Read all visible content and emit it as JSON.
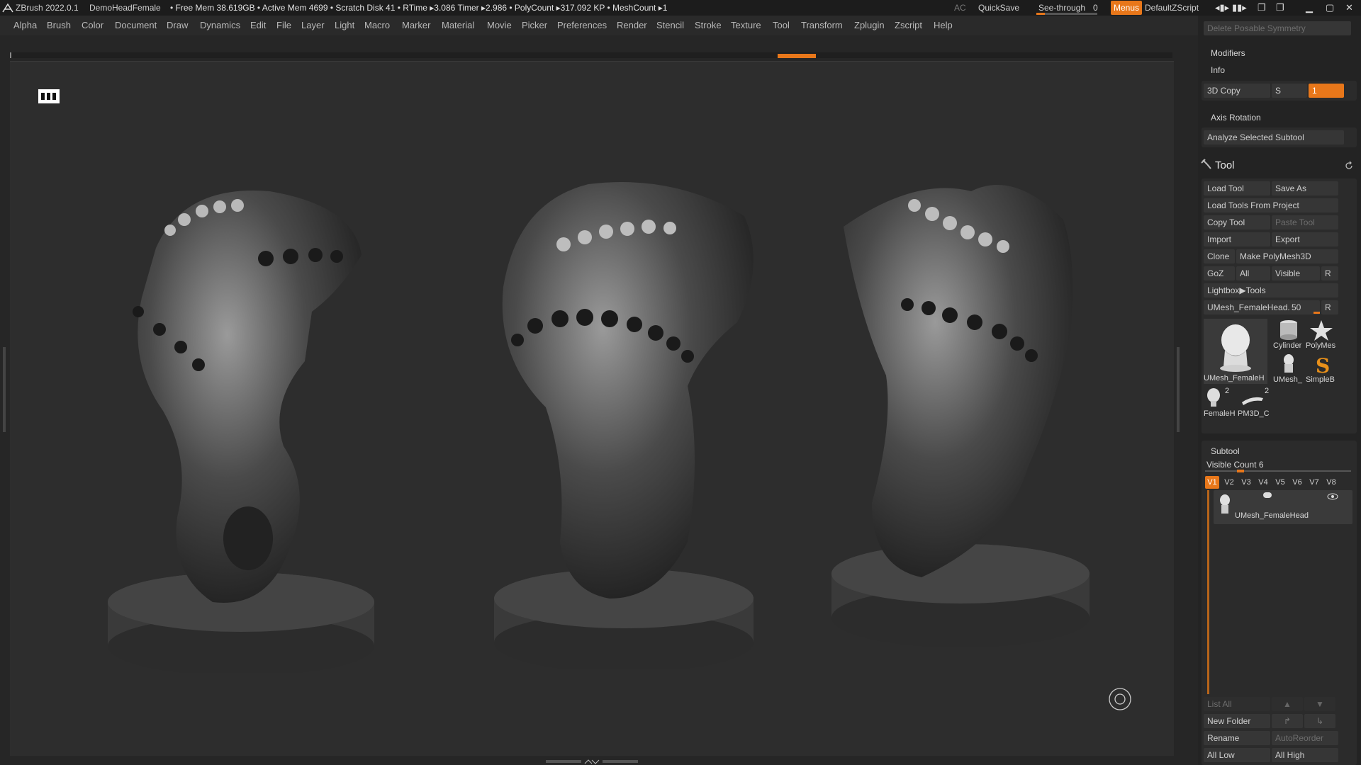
{
  "titlebar": {
    "app": "ZBrush 2022.0.1",
    "document": "DemoHeadFemale",
    "stats": "• Free Mem 38.619GB • Active Mem 4699 • Scratch Disk 41 • RTime ▸3.086 Timer ▸2.986 • PolyCount ▸317.092 KP  • MeshCount ▸1",
    "ac": "AC",
    "quicksave": "QuickSave",
    "see_through_label": "See-through",
    "see_through_value": "0",
    "menus": "Menus",
    "script": "DefaultZScript"
  },
  "menu": [
    "Alpha",
    "Brush",
    "Color",
    "Document",
    "Draw",
    "Dynamics",
    "Edit",
    "File",
    "Layer",
    "Light",
    "Macro",
    "Marker",
    "Material",
    "Movie",
    "Picker",
    "Preferences",
    "Render",
    "Stencil",
    "Stroke",
    "Texture",
    "Tool",
    "Transform",
    "Zplugin",
    "Zscript",
    "Help"
  ],
  "panel": {
    "delete_posable_symmetry": "Delete Posable Symmetry",
    "modifiers": "Modifiers",
    "info": "Info",
    "copy3d": "3D Copy",
    "s": "S",
    "copy_field_value": "1",
    "axis_rotation": "Axis Rotation",
    "analyze": "Analyze Selected Subtool",
    "tool_title": "Tool",
    "load_tool": "Load Tool",
    "save_as": "Save As",
    "load_from_project": "Load Tools From Project",
    "copy_tool": "Copy Tool",
    "paste_tool": "Paste Tool",
    "import": "Import",
    "export": "Export",
    "clone": "Clone",
    "make_polymesh": "Make PolyMesh3D",
    "goz": "GoZ",
    "all": "All",
    "visible": "Visible",
    "r": "R",
    "lightbox_tools": "Lightbox▶Tools",
    "current_tool": "UMesh_FemaleHead.",
    "current_tool_value": "50",
    "r2": "R",
    "thumbs": {
      "main": "UMesh_FemaleH",
      "cylinder": "Cylinder",
      "polymesh": "PolyMes",
      "umesh_small": "UMesh_",
      "simpleb": "SimpleB",
      "female": "FemaleH",
      "female_count": "2",
      "pm3d": "PM3D_C",
      "pm3d_count": "2"
    },
    "subtool": "Subtool",
    "visible_count": "Visible Count 6",
    "versions": [
      "V1",
      "V2",
      "V3",
      "V4",
      "V5",
      "V6",
      "V7",
      "V8"
    ],
    "subtool_item": "UMesh_FemaleHead",
    "list_all": "List All",
    "new_folder": "New Folder",
    "rename": "Rename",
    "autoreorder": "AutoReorder",
    "all_low": "All Low",
    "all_high": "All High"
  },
  "colors": {
    "accent": "#e8771a",
    "panel": "#232323",
    "canvas": "#2d2d2d"
  },
  "icons": [
    "zbrush-logo-icon",
    "minimize-icon",
    "maximize-icon",
    "close-icon",
    "hammer-icon",
    "refresh-icon",
    "rotate-gizmo-icon",
    "eye-icon"
  ]
}
